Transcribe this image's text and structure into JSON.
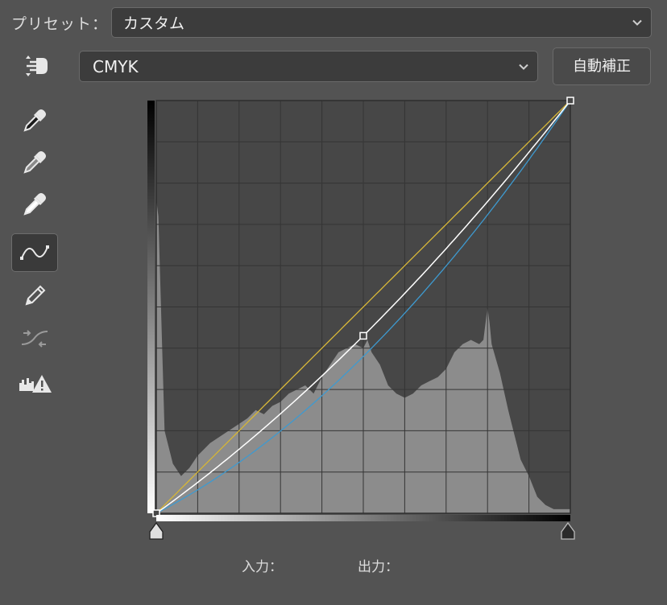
{
  "preset": {
    "label": "プリセット：",
    "value": "カスタム"
  },
  "channel": {
    "value": "CMYK"
  },
  "auto_button": {
    "label": "自動補正"
  },
  "tools": [
    {
      "name": "on-image-adjust-icon"
    },
    {
      "name": "black-point-eyedropper-icon"
    },
    {
      "name": "gray-point-eyedropper-icon"
    },
    {
      "name": "white-point-eyedropper-icon"
    },
    {
      "name": "curve-points-icon",
      "active": true
    },
    {
      "name": "pencil-icon"
    },
    {
      "name": "smooth-curve-icon"
    },
    {
      "name": "clipping-warning-icon"
    }
  ],
  "io": {
    "input_label": "入力：",
    "output_label": "出力："
  },
  "curves": {
    "white": [
      [
        0,
        0
      ],
      [
        50,
        43
      ],
      [
        100,
        100
      ]
    ],
    "yellow": [
      [
        0,
        0
      ],
      [
        50,
        50
      ],
      [
        100,
        100
      ]
    ],
    "cyan": [
      [
        0,
        0
      ],
      [
        50,
        38
      ],
      [
        100,
        100
      ]
    ]
  },
  "colors": {
    "background": "#535353",
    "graph_background": "#474747",
    "histogram": "#8c8c8c",
    "curve_white": "#ffffff",
    "curve_yellow": "#d8b838",
    "curve_cyan": "#3e9ad0"
  }
}
